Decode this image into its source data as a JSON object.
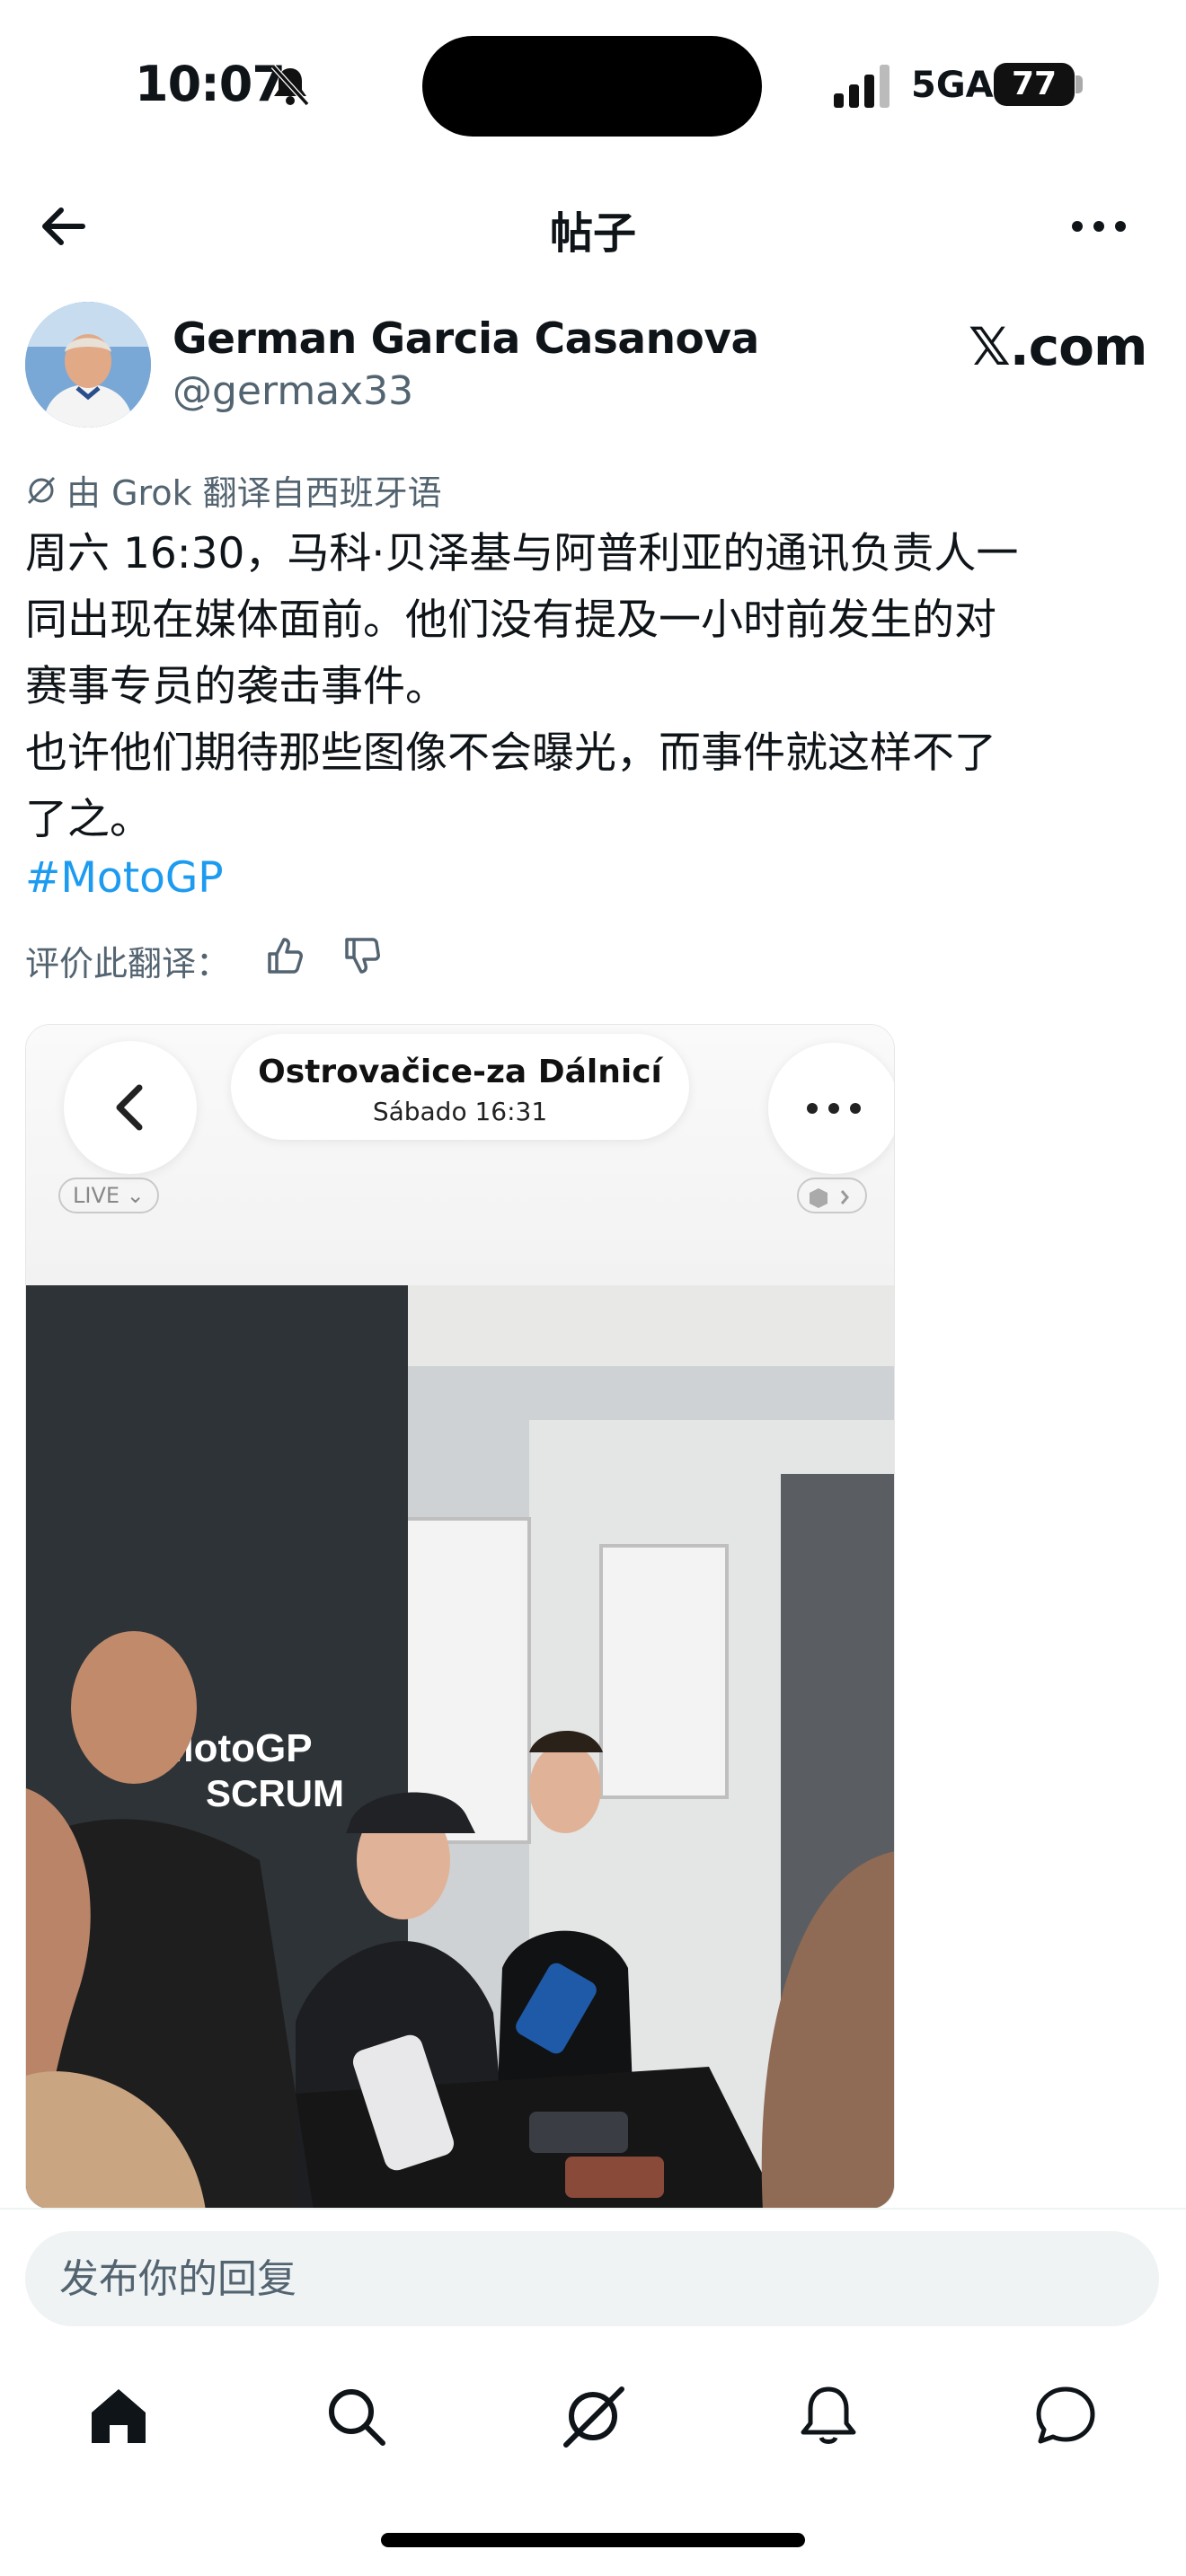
{
  "status_bar": {
    "time": "10:07",
    "network": "5GA",
    "battery": "77"
  },
  "nav": {
    "title": "帖子"
  },
  "author": {
    "name": "German Garcia Casanova",
    "handle": "@germax33",
    "watermark": "𝕏.com"
  },
  "translation": {
    "note": "由 Grok 翻译自西班牙语"
  },
  "post": {
    "text": "周六 16:30，马科·贝泽基与阿普利亚的通讯负责人一\n同出现在媒体面前。他们没有提及一小时前发生的对\n赛事专员的袭击事件。\n也许他们期待那些图像不会曝光，而事件就这样不了\n了之。",
    "hashtag": "#MotoGP",
    "rate_label": "评价此翻译："
  },
  "media": {
    "location": "Ostrovačice-za Dálnicí",
    "time": "Sábado  16:31",
    "live_label": "LIVE",
    "banner_line1": "MotoGP",
    "banner_line2": "SCRUM"
  },
  "reply": {
    "placeholder": "发布你的回复"
  },
  "tabs": [
    "home",
    "search",
    "grok",
    "notifications",
    "messages"
  ]
}
